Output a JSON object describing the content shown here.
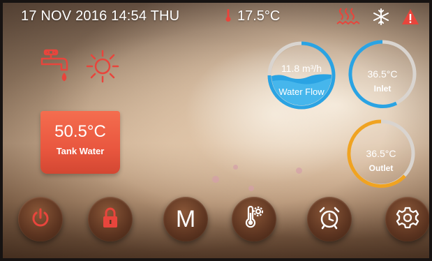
{
  "header": {
    "datetime": "17 NOV 2016 14:54 THU",
    "ambient_temp": "17.5°C"
  },
  "status_icons": [
    "heating-icon",
    "defrost-icon",
    "warning-icon"
  ],
  "mode_icons": [
    "tap-water-icon",
    "sun-icon"
  ],
  "tank": {
    "value": "50.5°C",
    "label": "Tank Water"
  },
  "gauges": {
    "water_flow": {
      "value": "11.8 m³/h",
      "label": "Water Flow"
    },
    "inlet": {
      "value": "36.5°C",
      "label": "Inlet"
    },
    "outlet": {
      "value": "36.5°C",
      "label": "Outlet"
    }
  },
  "toolbar": {
    "mode_label": "M",
    "buttons": [
      "power-button",
      "lock-button",
      "mode-button",
      "temperature-settings-button",
      "timer-button",
      "settings-button"
    ]
  },
  "colors": {
    "accent_red": "#e8453c",
    "tank_orange": "#ef6147",
    "gauge_blue": "#2aa3e3",
    "gauge_orange": "#f0a321",
    "button_brown": "#5c3420"
  }
}
